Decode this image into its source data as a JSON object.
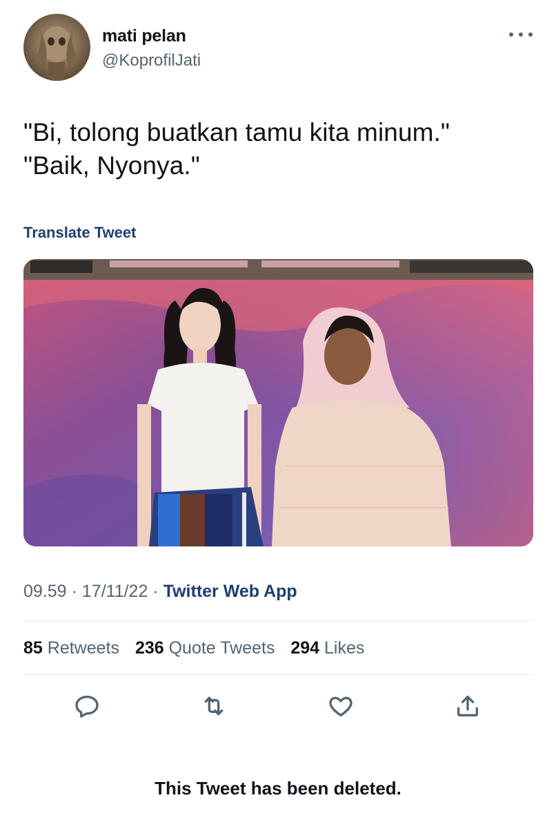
{
  "author": {
    "display_name": "mati pelan",
    "handle": "@KoprofilJati",
    "avatar_icon": "profile-avatar"
  },
  "tweet": {
    "text": "\"Bi, tolong buatkan tamu kita minum.\"\n\"Baik, Nyonya.\"",
    "translate_label": "Translate Tweet",
    "time": "09.59",
    "date": "17/11/22",
    "source": "Twitter Web App",
    "separator": "·"
  },
  "stats": {
    "retweets_count": "85",
    "retweets_label": "Retweets",
    "quotes_count": "236",
    "quotes_label": "Quote Tweets",
    "likes_count": "294",
    "likes_label": "Likes"
  },
  "actions": [
    "reply-icon",
    "retweet-icon",
    "like-icon",
    "share-icon"
  ],
  "footer": {
    "deleted_notice": "This Tweet has been deleted."
  },
  "colors": {
    "text": "#0f1419",
    "secondary": "#536471",
    "link": "#1d3f73",
    "divider": "#e6e9eb"
  }
}
